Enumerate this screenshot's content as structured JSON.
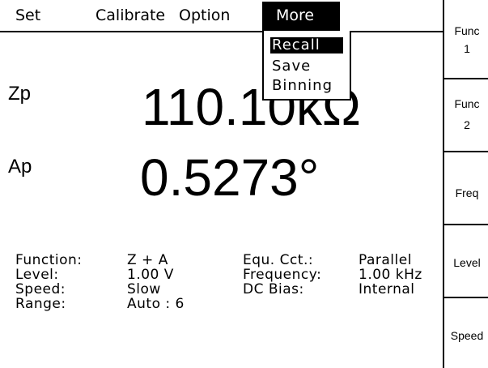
{
  "menubar": {
    "items": [
      "Set",
      "Calibrate",
      "Option"
    ],
    "active": "More"
  },
  "dropdown": {
    "items": [
      "Recall",
      "Save",
      "Binning"
    ],
    "selected_index": 0
  },
  "softkeys": [
    {
      "line1": "Func",
      "line2": "1"
    },
    {
      "line1": "Func",
      "line2": "2"
    },
    {
      "line1": "Freq",
      "line2": ""
    },
    {
      "line1": "Level",
      "line2": ""
    },
    {
      "line1": "Speed",
      "line2": ""
    }
  ],
  "readings": {
    "primary": {
      "label": "Zp",
      "value": "110.10kΩ"
    },
    "secondary": {
      "label": "Ap",
      "value": "0.5273°"
    }
  },
  "info": {
    "left": [
      {
        "label": "Function:",
        "value": "Z + A"
      },
      {
        "label": "Level:",
        "value": "1.00 V"
      },
      {
        "label": "Speed:",
        "value": "Slow"
      },
      {
        "label": "Range:",
        "value": "Auto : 6"
      }
    ],
    "right": [
      {
        "label": "Equ. Cct.:",
        "value": "Parallel"
      },
      {
        "label": "Frequency:",
        "value": "1.00 kHz"
      },
      {
        "label": "DC Bias:",
        "value": "Internal"
      }
    ]
  }
}
